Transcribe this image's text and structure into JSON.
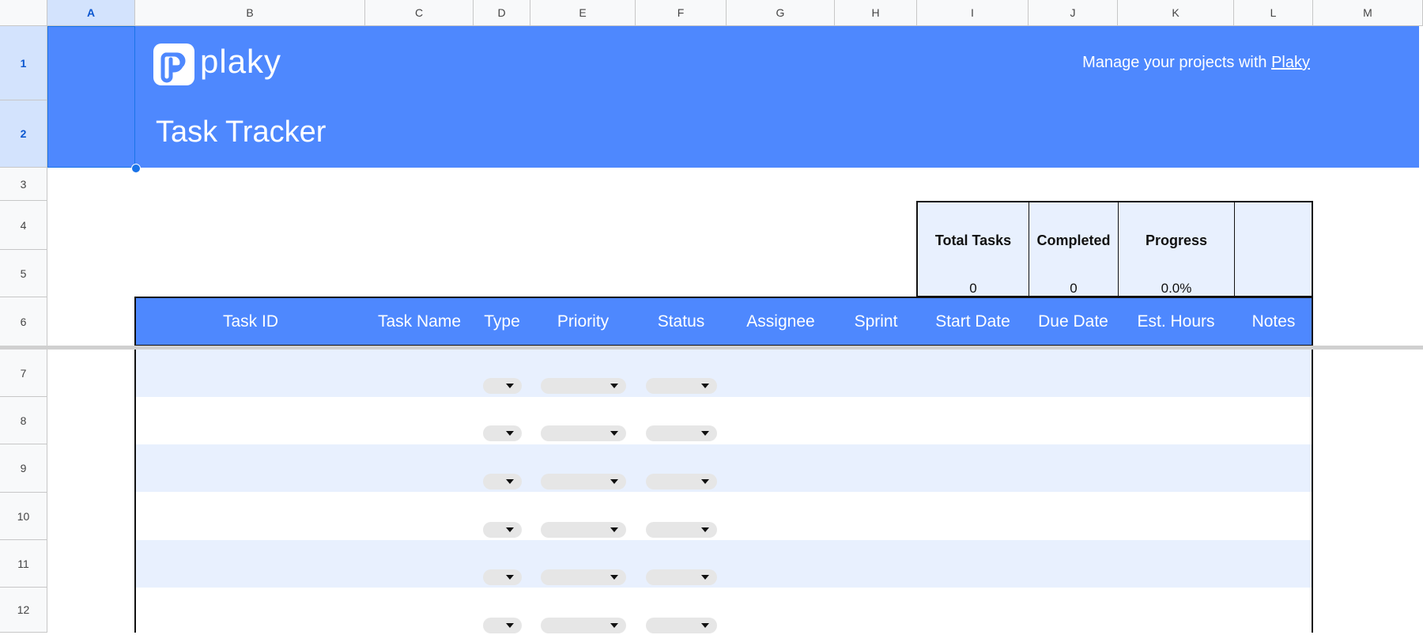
{
  "columns": [
    "A",
    "B",
    "C",
    "D",
    "E",
    "F",
    "G",
    "H",
    "I",
    "J",
    "K",
    "L",
    "M"
  ],
  "rows": [
    "1",
    "2",
    "3",
    "4",
    "5",
    "6",
    "7",
    "8",
    "9",
    "10",
    "11",
    "12"
  ],
  "banner": {
    "logo_text": "plaky",
    "tagline_prefix": "Manage your projects with ",
    "tagline_link": "Plaky",
    "title": "Task Tracker",
    "color": "#4e88fe"
  },
  "stats": {
    "total_tasks_label": "Total Tasks",
    "total_tasks_value": "0",
    "completed_label": "Completed",
    "completed_value": "0",
    "progress_label": "Progress",
    "progress_value": "0.0%"
  },
  "table": {
    "headers": [
      "Task ID",
      "Task Name",
      "Type",
      "Priority",
      "Status",
      "Assignee",
      "Sprint",
      "Start Date",
      "Due Date",
      "Est. Hours",
      "Notes"
    ]
  },
  "colors": {
    "accent": "#4e88fe",
    "band": "#e8f0fe",
    "selection": "#1a73e8"
  }
}
